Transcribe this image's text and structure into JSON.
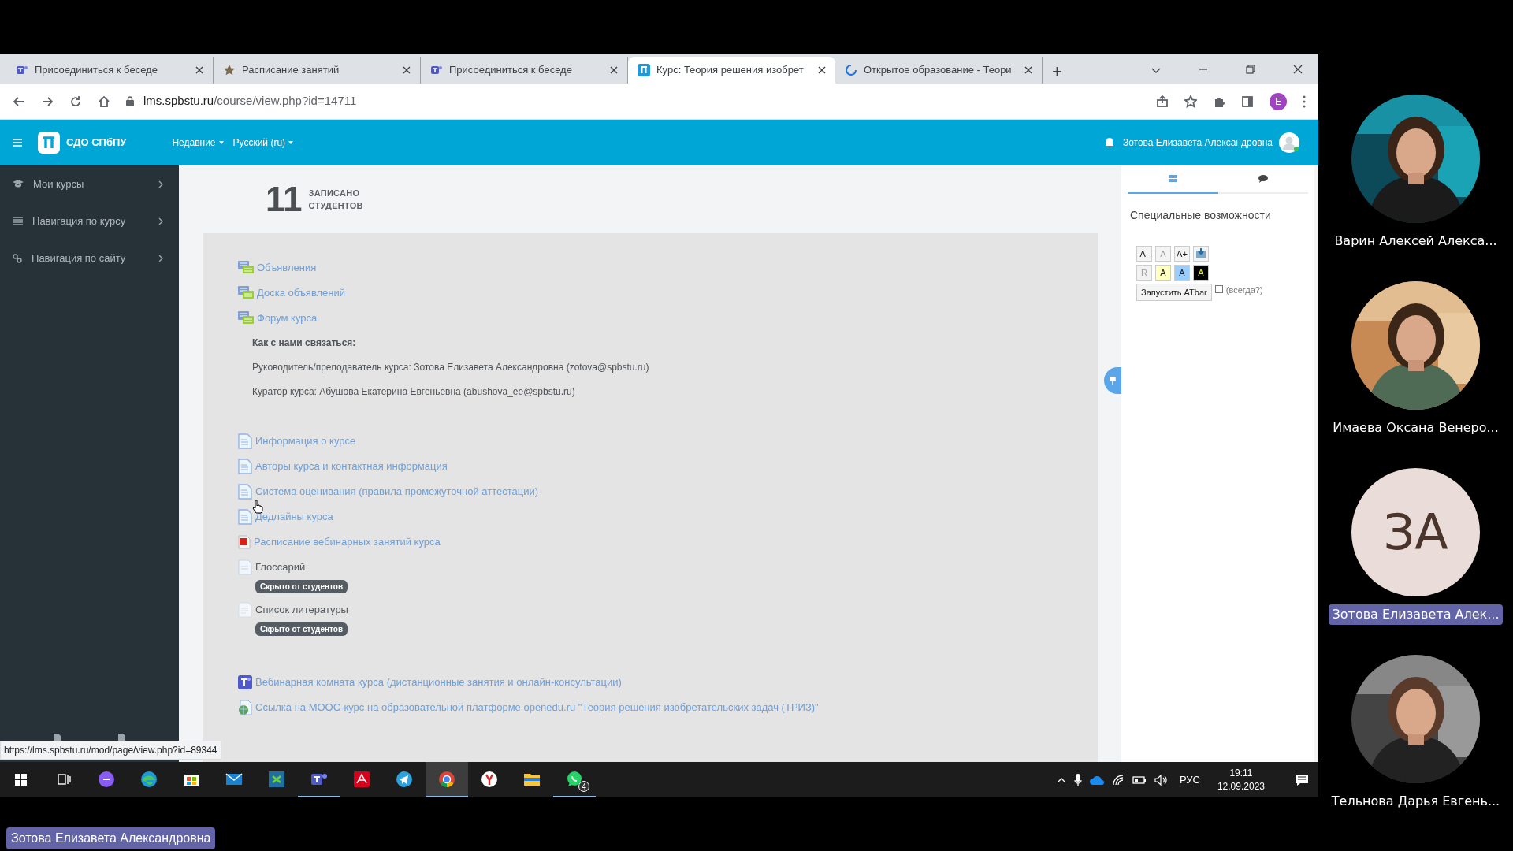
{
  "browser": {
    "tabs": [
      {
        "kind": "teams",
        "title": "Присоединиться к беседе",
        "selected": false
      },
      {
        "kind": "star",
        "title": "Расписание занятий",
        "selected": false
      },
      {
        "kind": "teams",
        "title": "Присоединиться к беседе",
        "selected": false
      },
      {
        "kind": "logo",
        "title": "Курс: Теория решения изобрет",
        "selected": true
      },
      {
        "kind": "loading",
        "title": "Открытое образование - Теори",
        "selected": false
      }
    ],
    "new_tab": "+",
    "address": {
      "host": "lms.spbstu.ru",
      "path": "/course/view.php?id=14711"
    },
    "profile_initial": "E",
    "status_url": "https://lms.spbstu.ru/mod/page/view.php?id=89344"
  },
  "header": {
    "brand": "СДО СПбПУ",
    "menus": [
      "Недавние",
      "Русский (ru)"
    ],
    "user": "Зотова Елизавета Александровна"
  },
  "sidebar": {
    "items": [
      {
        "kind": "courses",
        "label": "Мои курсы"
      },
      {
        "kind": "list",
        "label": "Навигация по курсу"
      },
      {
        "kind": "link",
        "label": "Навигация по сайту"
      }
    ]
  },
  "stats": {
    "number": "11",
    "label_1": "ЗАПИСАНО",
    "label_2": "СТУДЕНТОВ"
  },
  "sections": [
    {
      "items": [
        {
          "kind": "forum",
          "label": "Объявления",
          "hidden": false,
          "hovered": false
        },
        {
          "kind": "forum",
          "label": "Доска объявлений",
          "hidden": false,
          "hovered": false
        },
        {
          "kind": "forum",
          "label": "Форум курса",
          "hidden": false,
          "hovered": false
        }
      ],
      "notes": {
        "heading": "Как с нами связаться:",
        "lines": [
          "Руководитель/преподаватель курса: Зотова Елизавета Александровна (zotova@spbstu.ru)",
          "Куратор курса: Абушова Екатерина Евгеньевна (abushova_ee@spbstu.ru)"
        ]
      }
    },
    {
      "items": [
        {
          "kind": "page",
          "label": "Информация о курсе",
          "hidden": false,
          "hovered": false
        },
        {
          "kind": "page",
          "label": "Авторы курса и контактная информация",
          "hidden": false,
          "hovered": false
        },
        {
          "kind": "page",
          "label": "Система оценивания (правила промежуточной аттестации)",
          "hidden": false,
          "hovered": true
        },
        {
          "kind": "page",
          "label": "Дедлайны курса",
          "hidden": false,
          "hovered": false
        },
        {
          "kind": "pdf",
          "label": "Расписание вебинарных занятий курса",
          "hidden": false,
          "hovered": false
        },
        {
          "kind": "glossary",
          "label": "Глоссарий",
          "hidden": true,
          "hovered": false,
          "badge": "Скрыто от студентов"
        },
        {
          "kind": "book",
          "label": "Список литературы",
          "hidden": true,
          "hovered": false,
          "badge": "Скрыто от студентов"
        }
      ]
    },
    {
      "items": [
        {
          "kind": "teams",
          "label": "Вебинарная комната курса (дистанционные занятия и онлайн-консультации)",
          "hidden": false,
          "hovered": false
        },
        {
          "kind": "url",
          "label": "Ссылка на МООС-курс на образовательной платформе openedu.ru \"Теория решения изобретательских задач (ТРИЗ)\"",
          "hidden": false,
          "hovered": false
        }
      ]
    }
  ],
  "block": {
    "tabs": [
      {
        "kind": "grid",
        "selected": true
      },
      {
        "kind": "chat",
        "selected": false
      }
    ],
    "title": "Специальные возможности",
    "size_buttons": [
      {
        "kind": "text",
        "label": "A-",
        "disabled": false
      },
      {
        "kind": "text",
        "label": "A",
        "disabled": true
      },
      {
        "kind": "text",
        "label": "A+",
        "disabled": false
      },
      {
        "kind": "save"
      }
    ],
    "colour_buttons": [
      {
        "label": "R",
        "disabled": true,
        "color": "#f2f2f2"
      },
      {
        "label": "A",
        "disabled": false,
        "color": "#ffffc0"
      },
      {
        "label": "A",
        "disabled": false,
        "color": "#99ccff"
      },
      {
        "label": "A",
        "disabled": false,
        "color": "#000000"
      }
    ],
    "launch": "Запустить ATbar",
    "always": {
      "label": "(всегда?)",
      "checked": false
    }
  },
  "taskbar": {
    "apps": [
      {
        "kind": "taskview",
        "running": false,
        "selected": false
      },
      {
        "kind": "alice",
        "running": false,
        "selected": false
      },
      {
        "kind": "edge",
        "running": false,
        "selected": false
      },
      {
        "kind": "store",
        "running": false,
        "selected": false
      },
      {
        "kind": "mail",
        "running": false,
        "selected": false
      },
      {
        "kind": "sheet",
        "running": false,
        "selected": false
      },
      {
        "kind": "teams",
        "running": true,
        "selected": false
      },
      {
        "kind": "acrobat",
        "running": false,
        "selected": false
      },
      {
        "kind": "telegram",
        "running": false,
        "selected": false
      },
      {
        "kind": "chrome",
        "running": true,
        "selected": true
      },
      {
        "kind": "yandex",
        "running": false,
        "selected": false
      },
      {
        "kind": "explorer",
        "running": false,
        "selected": false
      },
      {
        "kind": "whatsapp",
        "running": true,
        "selected": false,
        "badge": "4"
      }
    ],
    "language": "РУС",
    "time": "19:11",
    "date": "12.09.2023"
  },
  "participants": [
    {
      "name": "Варин Алексей Алекса...",
      "highlighted": false
    },
    {
      "name": "Имаева Оксана Венеро...",
      "highlighted": false
    },
    {
      "kind": "initials",
      "initials": "ЗА",
      "name": "Зотова Елизавета Алек...",
      "highlighted": true
    },
    {
      "name": "Тельнова Дарья Евгень...",
      "highlighted": false
    }
  ],
  "presenter": "Зотова Елизавета Александровна"
}
